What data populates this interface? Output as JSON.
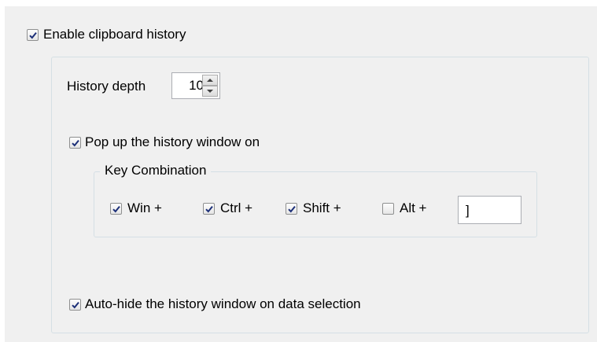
{
  "enable_history": {
    "label": "Enable clipboard history",
    "checked": true
  },
  "history_depth": {
    "label": "History depth",
    "value": "10"
  },
  "popup": {
    "label": "Pop up the history window on",
    "checked": true
  },
  "key_combination": {
    "title": "Key Combination",
    "modifiers": [
      {
        "label": "Win +",
        "checked": true
      },
      {
        "label": "Ctrl +",
        "checked": true
      },
      {
        "label": "Shift +",
        "checked": true
      },
      {
        "label": "Alt +",
        "checked": false
      }
    ],
    "key_value": "]"
  },
  "auto_hide": {
    "label": "Auto-hide the history window on data selection",
    "checked": true
  },
  "colors": {
    "check": "#1c2f78",
    "panel": "#f0f0f0",
    "group_border": "#d5dfe5"
  }
}
